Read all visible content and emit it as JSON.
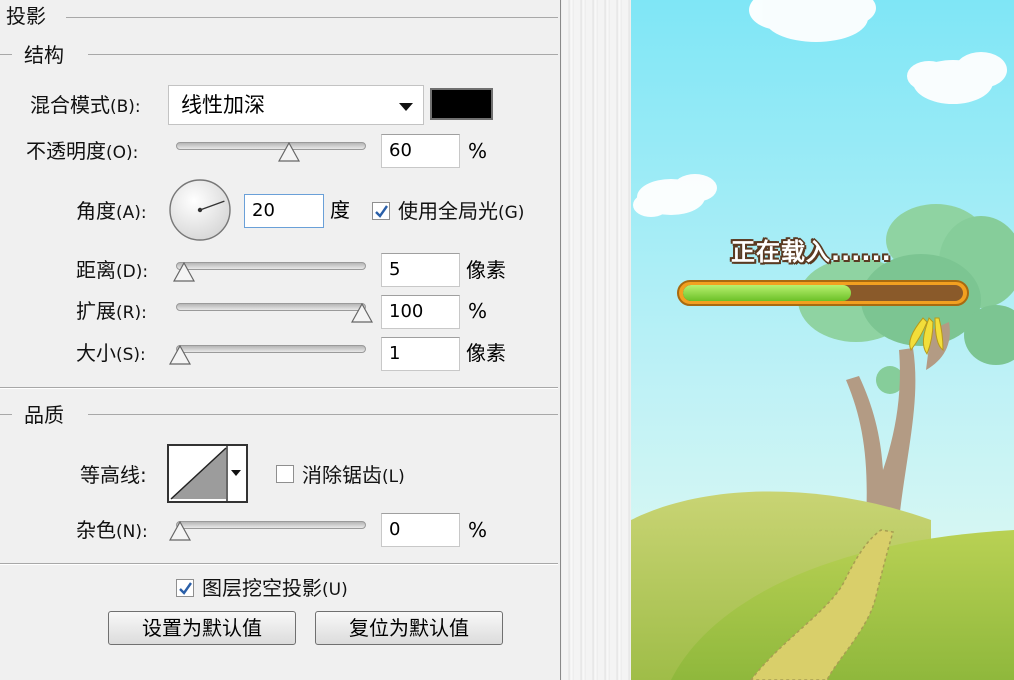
{
  "dialog": {
    "section_title": "投影",
    "structure": {
      "title": "结构",
      "blend_mode_label": "混合模式",
      "blend_mode_accel": "(B):",
      "blend_mode_value": "线性加深",
      "shadow_color": "#000000",
      "opacity_label": "不透明度",
      "opacity_accel": "(O):",
      "opacity_value": "60",
      "opacity_unit": "%",
      "opacity_fraction": 0.6,
      "angle_label": "角度",
      "angle_accel": "(A):",
      "angle_value": "20",
      "angle_unit": "度",
      "global_light_checked": true,
      "global_light_label": "使用全局光",
      "global_light_accel": "(G)",
      "distance_label": "距离",
      "distance_accel": "(D):",
      "distance_value": "5",
      "distance_unit": "像素",
      "distance_fraction": 0.02,
      "spread_label": "扩展",
      "spread_accel": "(R):",
      "spread_value": "100",
      "spread_unit": "%",
      "spread_fraction": 1.0,
      "size_label": "大小",
      "size_accel": "(S):",
      "size_value": "1",
      "size_unit": "像素",
      "size_fraction": 0.0
    },
    "quality": {
      "title": "品质",
      "contour_label": "等高线:",
      "anti_alias_checked": false,
      "anti_alias_label": "消除锯齿",
      "anti_alias_accel": "(L)",
      "noise_label": "杂色",
      "noise_accel": "(N):",
      "noise_value": "0",
      "noise_unit": "%",
      "noise_fraction": 0.0
    },
    "knockout_checked": true,
    "knockout_label": "图层挖空投影",
    "knockout_accel": "(U)",
    "make_default_label": "设置为默认值",
    "reset_default_label": "复位为默认值"
  },
  "game": {
    "loading_text": "正在载入......",
    "progress_fraction": 0.6,
    "colors": {
      "sky_top": "#7fe6f6",
      "sky_bottom": "#e4f9f2",
      "hill": "#a8c84a",
      "bar_fill": "#8ed84a",
      "bar_frame": "#f2a020"
    }
  }
}
